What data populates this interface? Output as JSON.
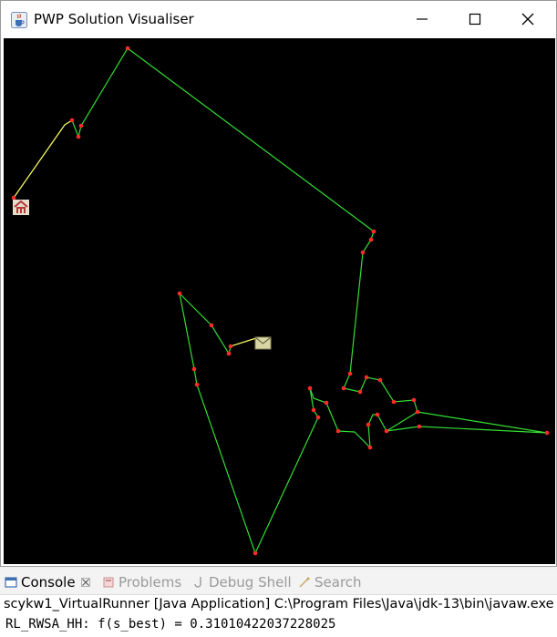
{
  "window": {
    "title": "PWP Solution Visualiser",
    "icon": "java-cup-icon",
    "controls": [
      "minimize",
      "maximize",
      "close"
    ]
  },
  "visualisation": {
    "background": "#000000",
    "route_color": "#33dd33",
    "highlight_color": "#ffff66",
    "node_color": "#ff2a2a",
    "depot_icon": "house-icon",
    "parcel_icon": "envelope-icon"
  },
  "console": {
    "tabs": [
      {
        "label": "Console",
        "icon": "console-icon",
        "active": true
      },
      {
        "label": "Problems",
        "icon": "problems-icon",
        "active": false
      },
      {
        "label": "Debug Shell",
        "icon": "debug-shell-icon",
        "active": false
      },
      {
        "label": "Search",
        "icon": "search-icon",
        "active": false
      }
    ],
    "run_header": "scykw1_VirtualRunner [Java Application] C:\\Program Files\\Java\\jdk-13\\bin\\javaw.exe",
    "output": "RL_RWSA_HH: f(s_best) = 0.31010422037228025"
  }
}
